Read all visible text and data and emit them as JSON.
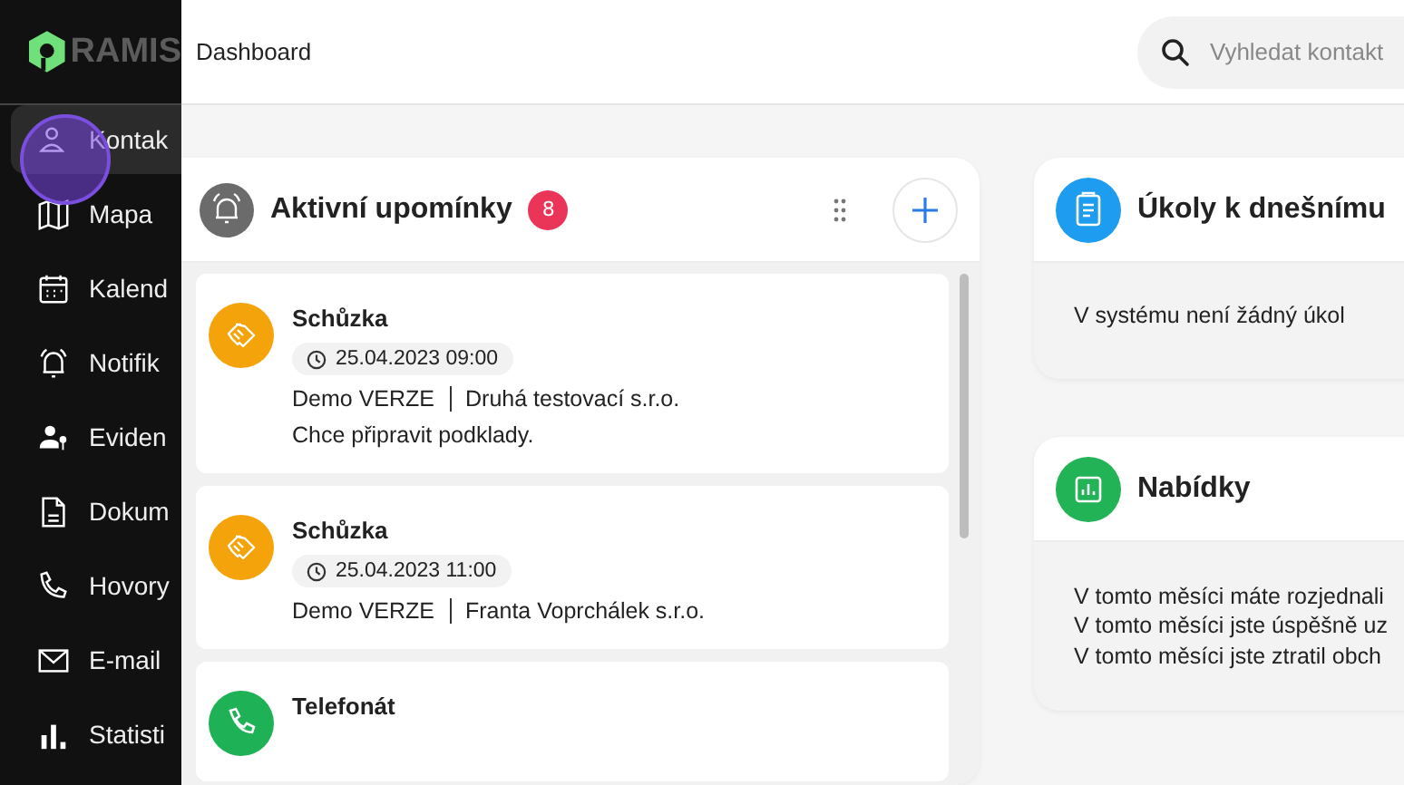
{
  "sidebar": {
    "logo": "RAMIS",
    "items": [
      {
        "label": "Kontak",
        "selected": true
      },
      {
        "label": "Mapa",
        "selected": false
      },
      {
        "label": "Kalend",
        "selected": false
      },
      {
        "label": "Notifik",
        "selected": false
      },
      {
        "label": "Eviden",
        "selected": false
      },
      {
        "label": "Dokum",
        "selected": false
      },
      {
        "label": "Hovory",
        "selected": false
      },
      {
        "label": "E-mail",
        "selected": false
      },
      {
        "label": "Statisti",
        "selected": false
      }
    ]
  },
  "header": {
    "breadcrumb": "Dashboard",
    "search": {
      "placeholder": "Vyhledat kontakt"
    }
  },
  "reminders": {
    "title": "Aktivní upomínky",
    "count": "8",
    "items": [
      {
        "kind": "meeting",
        "title": "Schůzka",
        "date": "25.04.2023 09:00",
        "owner": "Demo VERZE",
        "company": "Druhá testovací s.r.o.",
        "note": "Chce připravit podklady."
      },
      {
        "kind": "meeting",
        "title": "Schůzka",
        "date": "25.04.2023 11:00",
        "owner": "Demo VERZE",
        "company": "Franta Voprchálek s.r.o."
      },
      {
        "kind": "call",
        "title": "Telefonát"
      }
    ]
  },
  "tasks": {
    "title": "Úkoly k dnešnímu",
    "lines": [
      "V systému není žádný úkol"
    ]
  },
  "offers": {
    "title": "Nabídky",
    "lines": [
      "V tomto měsíci máte rozjednali",
      "V tomto měsíci jste úspěšně uz",
      "V tomto měsíci jste ztratil obch"
    ]
  }
}
